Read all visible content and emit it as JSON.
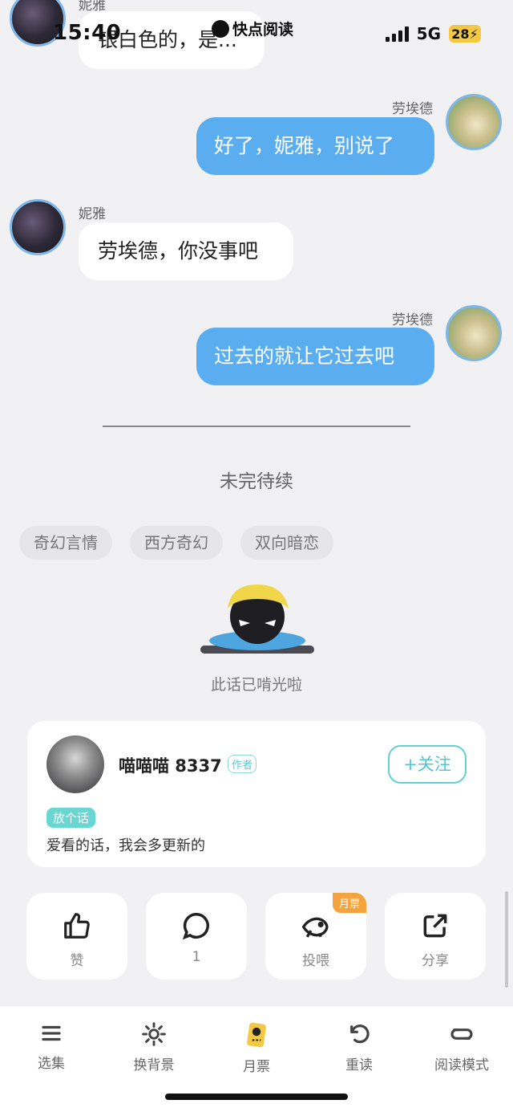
{
  "status_bar": {
    "time": "15:40",
    "network": "5G",
    "battery": "28"
  },
  "app_badge": "快点阅读",
  "chat": {
    "messages": [
      {
        "sender": "妮雅",
        "side": "left",
        "text": "银白色的，是..."
      },
      {
        "sender": "劳埃德",
        "side": "right",
        "text": "好了，妮雅，别说了"
      },
      {
        "sender": "妮雅",
        "side": "left",
        "text": "劳埃德，你没事吧"
      },
      {
        "sender": "劳埃德",
        "side": "right",
        "text": "过去的就让它过去吧"
      }
    ]
  },
  "divider": "——————————————————",
  "to_be_continued": "未完待续",
  "tags": [
    "奇幻言情",
    "西方奇幻",
    "双向暗恋"
  ],
  "end_label": "此话已啃光啦",
  "author": {
    "name": "喵喵喵 8337",
    "role_tag": "作者",
    "follow_label": "+关注",
    "note_badge": "放个话",
    "note_text": "爱看的话，我会多更新的"
  },
  "actions": [
    {
      "label": "赞",
      "icon": "thumbs-up-icon"
    },
    {
      "label": "1",
      "icon": "comment-icon"
    },
    {
      "label": "投喂",
      "icon": "fish-icon",
      "ribbon": "月票"
    },
    {
      "label": "分享",
      "icon": "share-icon"
    }
  ],
  "bottom_nav": [
    {
      "label": "选集",
      "icon": "menu-icon"
    },
    {
      "label": "换背景",
      "icon": "sun-icon"
    },
    {
      "label": "月票",
      "icon": "ticket-icon"
    },
    {
      "label": "重读",
      "icon": "undo-icon"
    },
    {
      "label": "阅读模式",
      "icon": "loop-icon"
    }
  ],
  "colors": {
    "accent_blue": "#5aaef0",
    "follow_teal": "#4fc6cf",
    "ribbon_orange": "#f5a33e",
    "background": "#f1f1f3"
  }
}
